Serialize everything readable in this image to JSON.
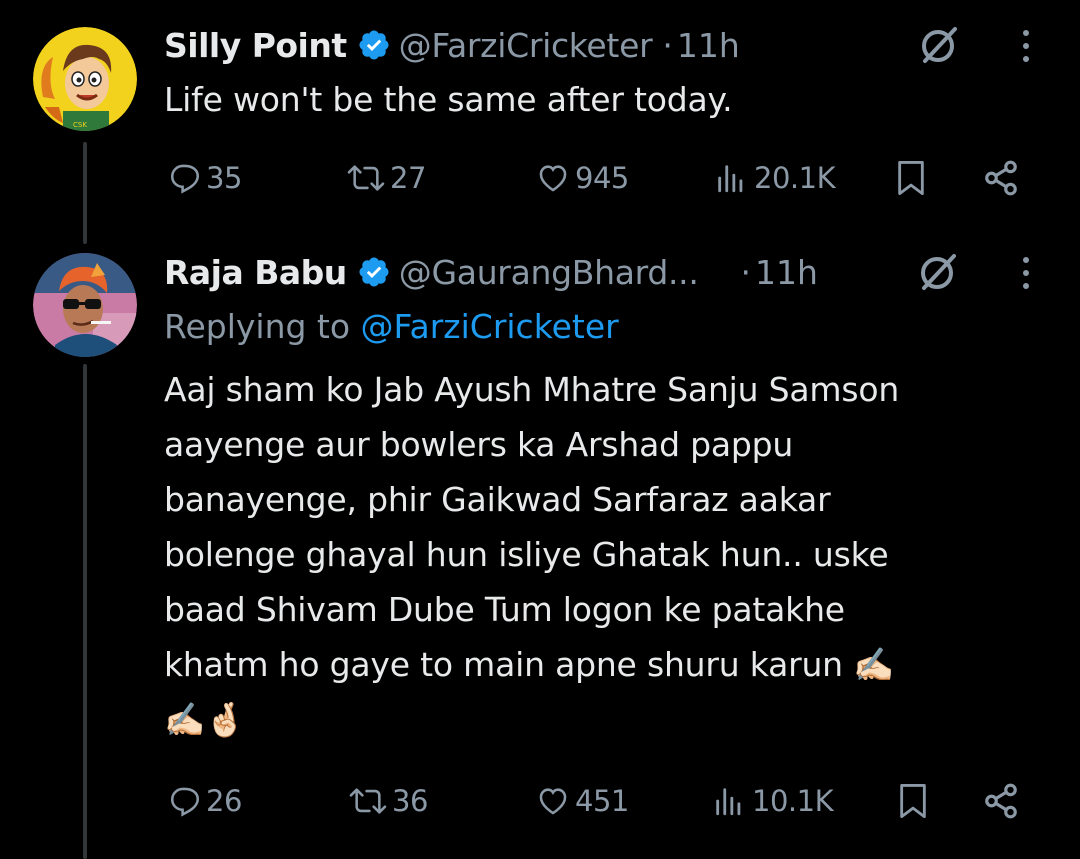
{
  "tweets": [
    {
      "display_name": "Silly Point",
      "handle": "@FarziCricketer",
      "separator": "·",
      "time": "11h",
      "text": "Life won't be the same after today.",
      "stats": {
        "replies": "35",
        "reposts": "27",
        "likes": "945",
        "views": "20.1K"
      },
      "avatar_icon": "cartoon-avatar-icon"
    },
    {
      "display_name": "Raja Babu",
      "handle": "@GaurangBhard...",
      "separator": "·",
      "time": "11h",
      "replying_prefix": "Replying to",
      "replying_to": "@FarziCricketer",
      "text_lines": [
        "Aaj sham ko Jab Ayush Mhatre Sanju Samson",
        "aayenge aur bowlers ka Arshad pappu",
        "banayenge, phir Gaikwad Sarfaraz aakar",
        "bolenge ghayal hun isliye Ghatak hun.. uske",
        "baad Shivam Dube Tum logon ke patakhe",
        "khatm ho gaye to main apne shuru karun ✍🏻",
        "✍🏻🤞🏻"
      ],
      "stats": {
        "replies": "26",
        "reposts": "36",
        "likes": "451",
        "views": "10.1K"
      },
      "avatar_icon": "sunglasses-avatar-icon"
    }
  ],
  "colors": {
    "background": "#000000",
    "primary_text": "#e7e9ea",
    "secondary_text": "#8b98a5",
    "link": "#1d9bf0",
    "verified_badge": "#1d9bf0",
    "thread_line": "#333639"
  }
}
